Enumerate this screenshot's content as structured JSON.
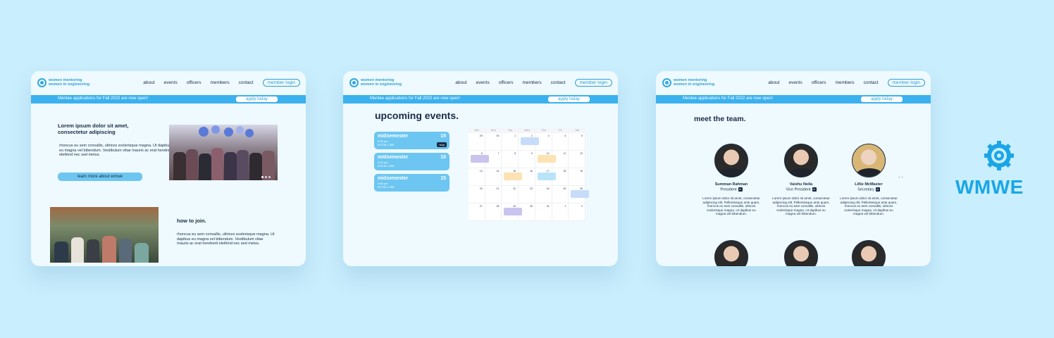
{
  "nav": {
    "logo_line1": "women mentoring",
    "logo_line2": "women in engineering",
    "links": [
      "about",
      "events",
      "officers",
      "members",
      "contact"
    ],
    "login": "member login"
  },
  "banner": {
    "text": "Mentee applications for Fall 2022 are now open!",
    "apply": "apply today"
  },
  "home": {
    "heading": "Lorem ipsum dolor sit amet, consectetur adipiscing",
    "body": "rhoncus eu sem convallis, ultrices scelerisque magna. Ut dapibus eu magna vel bibendum. Vestibulum vitae mauris ac erat hendrerit eleifend nec sed metus.",
    "learn_more": "learn more about wmwe",
    "join_title": "how to join.",
    "join_body": "rhoncus eu sem convallis, ultrices scelerisque magna. Ut dapibus eu magna vel bibendum. Vestibulum vitae mauris ac erat hendrerit eleifend nec sed metus."
  },
  "events": {
    "title": "upcoming events.",
    "items": [
      {
        "name": "midsemester",
        "day": "15",
        "time": "9:00 pm",
        "place": "ECCW 1.395",
        "rsvp": "rsvp"
      },
      {
        "name": "midsemester",
        "day": "15",
        "time": "9:00 pm",
        "place": "ECCW 1.395"
      },
      {
        "name": "midsemester",
        "day": "15",
        "time": "9:00 pm",
        "place": "ECCW 1.395"
      }
    ],
    "calendar": {
      "weekdays": [
        "Sun",
        "Mon",
        "Tue",
        "Wed",
        "Thu",
        "Fri",
        "Sat"
      ],
      "days": [
        "29",
        "30",
        "1",
        "2",
        "3",
        "4",
        "5",
        "6",
        "7",
        "8",
        "9",
        "10",
        "11",
        "12",
        "13",
        "14",
        "15",
        "16",
        "17",
        "18",
        "19",
        "20",
        "21",
        "22",
        "23",
        "24",
        "25",
        "26",
        "27",
        "28",
        "29",
        "30",
        "31",
        "1",
        "2"
      ]
    }
  },
  "team": {
    "title": "meet the team.",
    "members": [
      {
        "name": "Summan Rahman",
        "role": "President",
        "bio": "Lorem ipsum dolor sit amet, consectetur adipiscing elit. Pellentesque ante quam, rhoncus eu sem convallis, ultrices scelerisque magna. Ut dapibus eu magna vel bibendum."
      },
      {
        "name": "Vaishu Nella",
        "role": "Vice President",
        "bio": "Lorem ipsum dolor sit amet, consectetur adipiscing elit. Pellentesque ante quam, rhoncus eu sem convallis, ultrices scelerisque magna. Ut dapibus eu magna vel bibendum."
      },
      {
        "name": "Lillie McMaster",
        "role": "Secretary",
        "bio": "Lorem ipsum dolor sit amet, consectetur adipiscing elit. Pellentesque ante quam, rhoncus eu sem convallis, ultrices scelerisque magna. Ut dapibus eu magna vel bibendum."
      }
    ],
    "linkedin_icon": "in"
  },
  "brand": {
    "name": "WMWE",
    "color": "#1aa6e6"
  },
  "colors": {
    "accent": "#3bb1ee",
    "text": "#1b2a44",
    "background": "#c9eefd"
  }
}
